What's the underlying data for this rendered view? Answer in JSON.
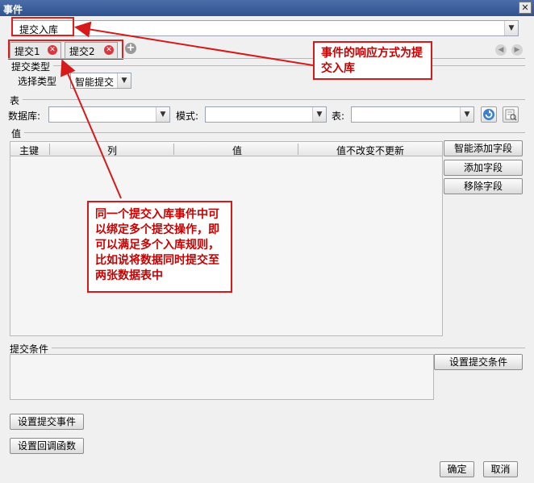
{
  "window": {
    "title": "事件",
    "close_glyph": "✕"
  },
  "event": {
    "selected": "提交入库"
  },
  "tabs": [
    {
      "label": "提交1"
    },
    {
      "label": "提交2"
    }
  ],
  "commit_type": {
    "group_label": "提交类型",
    "select_label": "选择类型",
    "select_value": "智能提交"
  },
  "table_section": {
    "group_label": "表",
    "database_label": "数据库:",
    "schema_label": "模式:",
    "table_label": "表:"
  },
  "values_section": {
    "group_label": "值",
    "columns": [
      "主键",
      "列",
      "值",
      "值不改变不更新"
    ],
    "smart_add_button": "智能添加字段",
    "add_button": "添加字段",
    "remove_button": "移除字段"
  },
  "condition_section": {
    "group_label": "提交条件",
    "set_button": "设置提交条件"
  },
  "bottom": {
    "set_event_button": "设置提交事件",
    "set_callback_button": "设置回调函数",
    "ok_button": "确定",
    "cancel_button": "取消"
  },
  "annotations": {
    "note1": "事件的响应方式为提交入库",
    "note2": "同一个提交入库事件中可以绑定多个提交操作，即可以满足多个入库规则，比如说将数据同时提交至两张数据表中"
  },
  "colors": {
    "annotation_red": "#d61919",
    "titlebar": "#2f5290"
  }
}
